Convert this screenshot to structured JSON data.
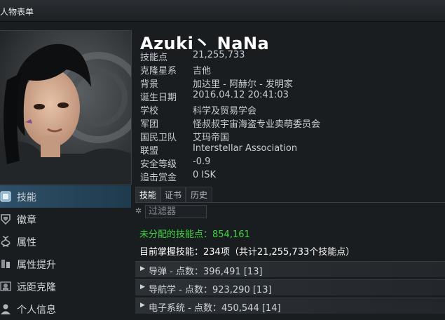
{
  "window": {
    "title": "人物表单"
  },
  "character": {
    "name": "Azuki丶 NaNa",
    "fields": [
      {
        "label": "技能点",
        "value": "21,255,733"
      },
      {
        "label": "克隆星系",
        "value": "吉他"
      },
      {
        "label": "背景",
        "value": "加达里 - 阿赫尔 - 发明家"
      },
      {
        "label": "诞生日期",
        "value": "2016.04.12 20:41:03"
      },
      {
        "label": "学校",
        "value": "科学及贸易学会"
      },
      {
        "label": "军团",
        "value": "怪叔叔宇宙海盗专业卖萌委员会"
      },
      {
        "label": "国民卫队",
        "value": "艾玛帝国"
      },
      {
        "label": "联盟",
        "value": "Interstellar Association"
      },
      {
        "label": "安全等级",
        "value": "-0.9"
      },
      {
        "label": "追击赏金",
        "value": "0 ISK"
      }
    ]
  },
  "sidebar": {
    "items": [
      {
        "label": "技能",
        "icon": "skills-icon",
        "active": true
      },
      {
        "label": "徽章",
        "icon": "decorations-icon"
      },
      {
        "label": "属性",
        "icon": "attributes-icon"
      },
      {
        "label": "属性提升",
        "icon": "augmentations-icon"
      },
      {
        "label": "远距克隆",
        "icon": "jump-clone-icon"
      },
      {
        "label": "个人信息",
        "icon": "bio-icon"
      }
    ]
  },
  "tabs": [
    {
      "label": "技能",
      "active": true
    },
    {
      "label": "证书"
    },
    {
      "label": "历史"
    }
  ],
  "filter": {
    "placeholder": "过滤器"
  },
  "skills": {
    "unallocated": "未分配的技能点：854,161",
    "trained": "目前掌握技能：234项（共计21,255,733个技能点）",
    "groups": [
      {
        "label": "导弹 - 点数：396,491 [13]"
      },
      {
        "label": "导航学 - 点数：923,290 [13]"
      },
      {
        "label": "电子系统 - 点数：450,544 [14]"
      }
    ]
  }
}
